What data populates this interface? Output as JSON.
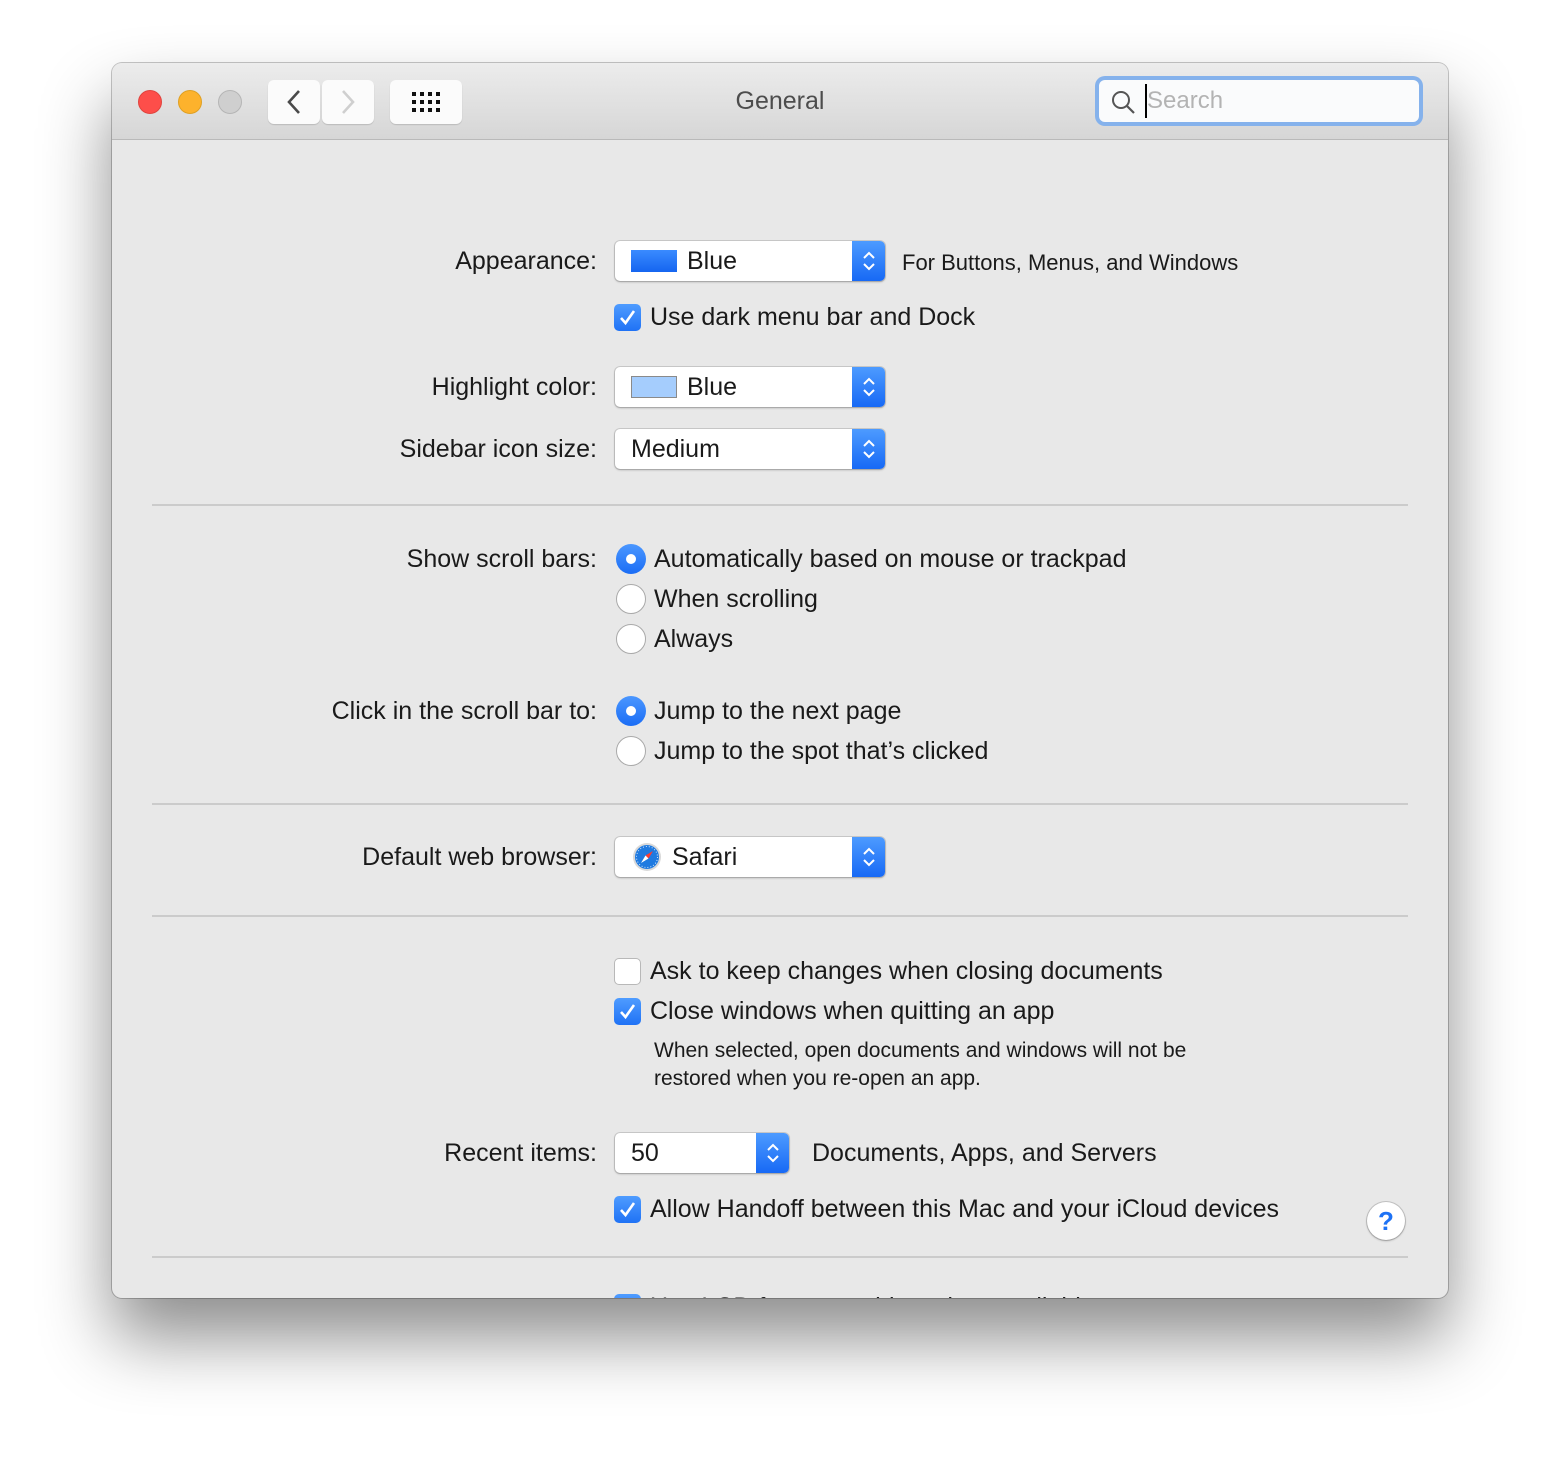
{
  "window": {
    "title": "General",
    "search": {
      "placeholder": "Search",
      "value": ""
    },
    "nav": {
      "back": "back",
      "forward": "forward",
      "show_all": "show-all"
    }
  },
  "appearance": {
    "label": "Appearance:",
    "value": "Blue",
    "swatch_color": "#2a79f5",
    "note": "For Buttons, Menus, and Windows"
  },
  "dark_menu": {
    "label": "Use dark menu bar and Dock",
    "checked": true
  },
  "highlight": {
    "label": "Highlight color:",
    "value": "Blue",
    "swatch_color": "#a5cdfd"
  },
  "sidebar_icon_size": {
    "label": "Sidebar icon size:",
    "value": "Medium"
  },
  "show_scroll_bars": {
    "label": "Show scroll bars:",
    "options": [
      {
        "label": "Automatically based on mouse or trackpad",
        "selected": true
      },
      {
        "label": "When scrolling",
        "selected": false
      },
      {
        "label": "Always",
        "selected": false
      }
    ]
  },
  "click_scroll_bar": {
    "label": "Click in the scroll bar to:",
    "options": [
      {
        "label": "Jump to the next page",
        "selected": true
      },
      {
        "label": "Jump to the spot that’s clicked",
        "selected": false
      }
    ]
  },
  "default_browser": {
    "label": "Default web browser:",
    "value": "Safari"
  },
  "ask_keep_changes": {
    "label": "Ask to keep changes when closing documents",
    "checked": false
  },
  "close_windows": {
    "label": "Close windows when quitting an app",
    "checked": true,
    "description_line1": "When selected, open documents and windows will not be",
    "description_line2": "restored when you re-open an app."
  },
  "recent_items": {
    "label": "Recent items:",
    "value": "50",
    "note": "Documents, Apps, and Servers"
  },
  "handoff": {
    "label": "Allow Handoff between this Mac and your iCloud devices",
    "checked": true
  },
  "lcd_smoothing": {
    "label": "Use LCD font smoothing when available",
    "checked": true
  },
  "help": {
    "glyph": "?"
  },
  "colors": {
    "accent": "#1f72f5",
    "background": "#e8e8e8",
    "close": "#fd4e4a",
    "minimize": "#fdb22c",
    "zoom": "#cfcfcf"
  }
}
